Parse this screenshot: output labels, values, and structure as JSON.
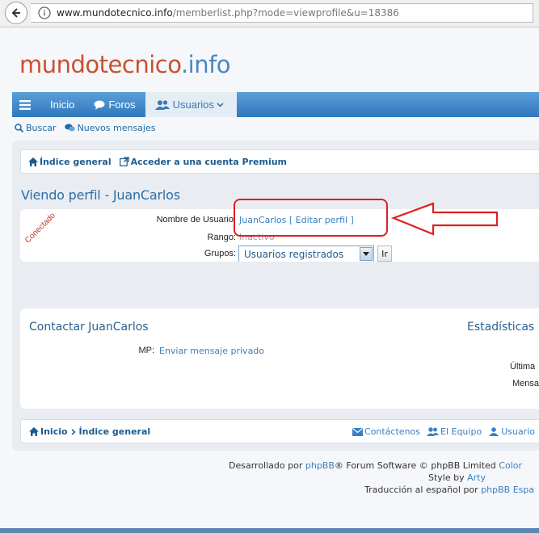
{
  "browser": {
    "url_host": "www.mundotecnico.info",
    "url_path": "/memberlist.php?mode=viewprofile&u=18386"
  },
  "site": {
    "logo_main": "mundotecnico",
    "logo_tld": ".info"
  },
  "navbar": {
    "items": [
      {
        "label": "Inicio"
      },
      {
        "label": "Foros"
      },
      {
        "label": "Usuarios"
      }
    ]
  },
  "quicklinks": {
    "search": "Buscar",
    "new_messages": "Nuevos mensajes"
  },
  "breadcrumb": {
    "index": "Índice general",
    "premium": "Acceder a una cuenta Premium"
  },
  "profile": {
    "title": "Viendo perfil - JuanCarlos",
    "status_ribbon": "Conectado",
    "username_label": "Nombre de Usuario:",
    "username_value": "JuanCarlos",
    "edit_profile": "[ Editar perfil ]",
    "rank_label": "Rango:",
    "rank_value": "Inactivo",
    "groups_label": "Grupos:",
    "groups_selected": "Usuarios registrados",
    "go_button": "Ir"
  },
  "contact": {
    "title": "Contactar JuanCarlos",
    "stats_title": "Estadísticas",
    "mp_label": "MP:",
    "mp_value": "Enviar mensaje privado",
    "stat_row1": "Última",
    "stat_row2": "Mensa"
  },
  "footer_nav": {
    "home": "Inicio",
    "index": "Índice general",
    "contact": "Contáctenos",
    "team": "El Equipo",
    "users": "Usuario"
  },
  "credits": {
    "line1_prefix": "Desarrollado por",
    "line1_link": "phpBB",
    "line1_suffix": "® Forum Software © phpBB Limited",
    "line1_link2": "Color",
    "line2_prefix": "Style by",
    "line2_link": "Arty",
    "line3_prefix": "Traducción al español por",
    "line3_link": "phpBB Espa"
  },
  "colors": {
    "accent_blue": "#2f78bd",
    "logo_red": "#c9512f",
    "annotation_red": "#e02020"
  }
}
